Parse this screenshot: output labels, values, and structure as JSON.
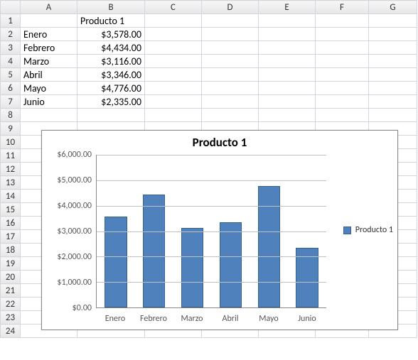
{
  "columns": [
    "A",
    "B",
    "C",
    "D",
    "E",
    "F",
    "G"
  ],
  "rows": [
    "1",
    "2",
    "3",
    "4",
    "5",
    "6",
    "7",
    "8",
    "9",
    "10",
    "11",
    "12",
    "13",
    "14",
    "15",
    "16",
    "17",
    "18",
    "19",
    "20",
    "21",
    "22",
    "23",
    "24"
  ],
  "cells": {
    "B1": "Producto 1",
    "A2": "Enero",
    "B2": "$3,578.00",
    "A3": "Febrero",
    "B3": "$4,434.00",
    "A4": "Marzo",
    "B4": "$3,116.00",
    "A5": "Abril",
    "B5": "$3,346.00",
    "A6": "Mayo",
    "B6": "$4,776.00",
    "A7": "Junio",
    "B7": "$2,335.00"
  },
  "chart_data": {
    "type": "bar",
    "title": "Producto 1",
    "categories": [
      "Enero",
      "Febrero",
      "Marzo",
      "Abril",
      "Mayo",
      "Junio"
    ],
    "series": [
      {
        "name": "Producto 1",
        "values": [
          3578.0,
          4434.0,
          3116.0,
          3346.0,
          4776.0,
          2335.0
        ]
      }
    ],
    "ylim": [
      0,
      6000
    ],
    "yticks": [
      0,
      1000,
      2000,
      3000,
      4000,
      5000,
      6000
    ],
    "ytick_labels": [
      "$0.00",
      "$1,000.00",
      "$2,000.00",
      "$3,000.00",
      "$4,000.00",
      "$5,000.00",
      "$6,000.00"
    ],
    "xlabel": "",
    "ylabel": "",
    "legend_position": "right"
  }
}
